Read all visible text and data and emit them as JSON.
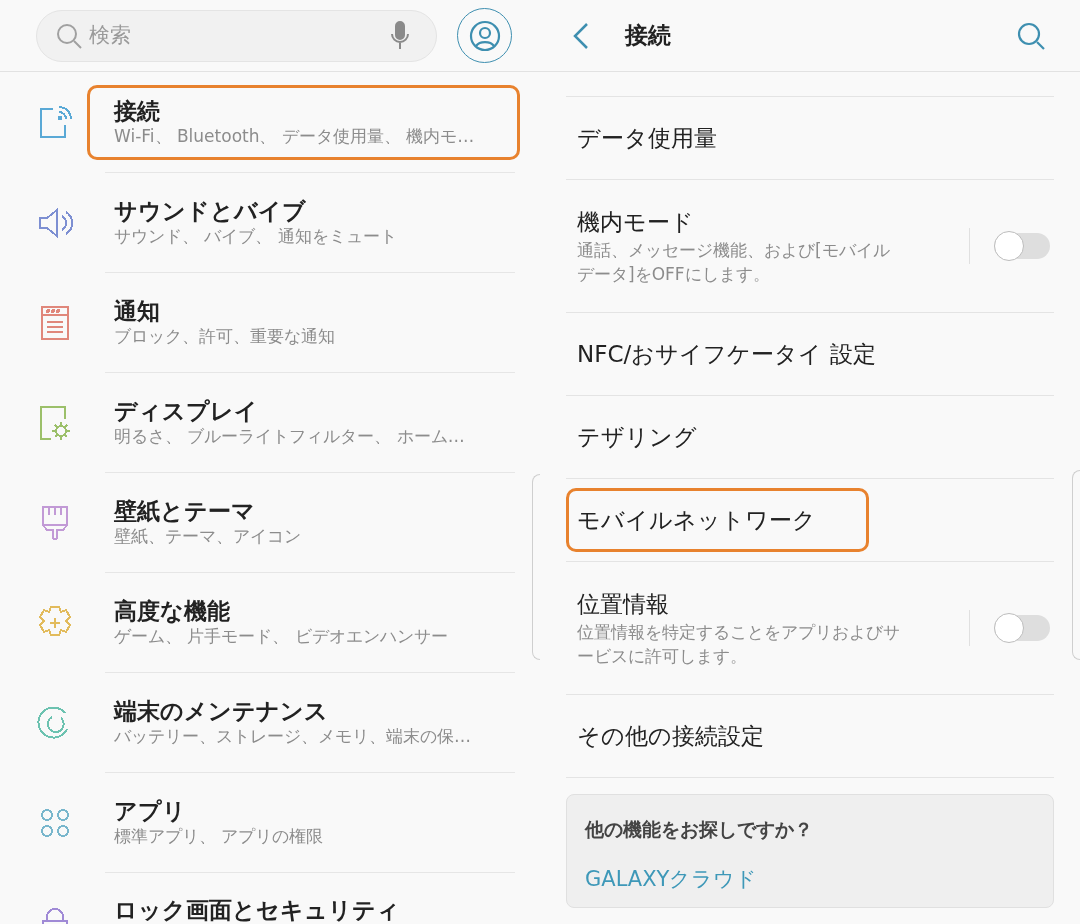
{
  "left_screen": {
    "search": {
      "placeholder": "検索"
    },
    "items": [
      {
        "title": "接続",
        "subtitle": "Wi-Fi、 Bluetooth、 データ使用量、 機内モ…",
        "color": "#5aa9d6",
        "highlighted": true
      },
      {
        "title": "サウンドとバイブ",
        "subtitle": "サウンド、 バイブ、 通知をミュート",
        "color": "#7d8fd2",
        "highlighted": false
      },
      {
        "title": "通知",
        "subtitle": "ブロック、許可、重要な通知",
        "color": "#e0877b",
        "highlighted": false
      },
      {
        "title": "ディスプレイ",
        "subtitle": "明るさ、 ブルーライトフィルター、 ホーム…",
        "color": "#9cc06a",
        "highlighted": false
      },
      {
        "title": "壁紙とテーマ",
        "subtitle": "壁紙、テーマ、アイコン",
        "color": "#c29ad6",
        "highlighted": false
      },
      {
        "title": "高度な機能",
        "subtitle": "ゲーム、 片手モード、 ビデオエンハンサー",
        "color": "#e2bb5c",
        "highlighted": false
      },
      {
        "title": "端末のメンテナンス",
        "subtitle": "バッテリー、ストレージ、メモリ、端末の保…",
        "color": "#6cc2b0",
        "highlighted": false
      },
      {
        "title": "アプリ",
        "subtitle": "標準アプリ、 アプリの権限",
        "color": "#78b6cc",
        "highlighted": false
      },
      {
        "title": "ロック画面とセキュリティ",
        "color": "#a08ad6",
        "highlighted": false
      }
    ]
  },
  "right_screen": {
    "title": "接続",
    "items": [
      {
        "kind": "plain",
        "title": "データ使用量",
        "highlighted": false
      },
      {
        "kind": "toggle",
        "title": "機内モード",
        "subtitle": "通話、メッセージ機能、および[モバイルデータ]をOFFにします。",
        "on": false
      },
      {
        "kind": "plain",
        "title": "NFC/おサイフケータイ 設定",
        "highlighted": false
      },
      {
        "kind": "plain",
        "title": "テザリング",
        "highlighted": false
      },
      {
        "kind": "plain",
        "title": "モバイルネットワーク",
        "highlighted": true
      },
      {
        "kind": "toggle",
        "title": "位置情報",
        "subtitle": "位置情報を特定することをアプリおよびサービスに許可します。",
        "on": false
      },
      {
        "kind": "plain",
        "title": "その他の接続設定",
        "highlighted": false
      }
    ],
    "card": {
      "heading": "他の機能をお探しですか？",
      "link": "GALAXYクラウド"
    }
  }
}
